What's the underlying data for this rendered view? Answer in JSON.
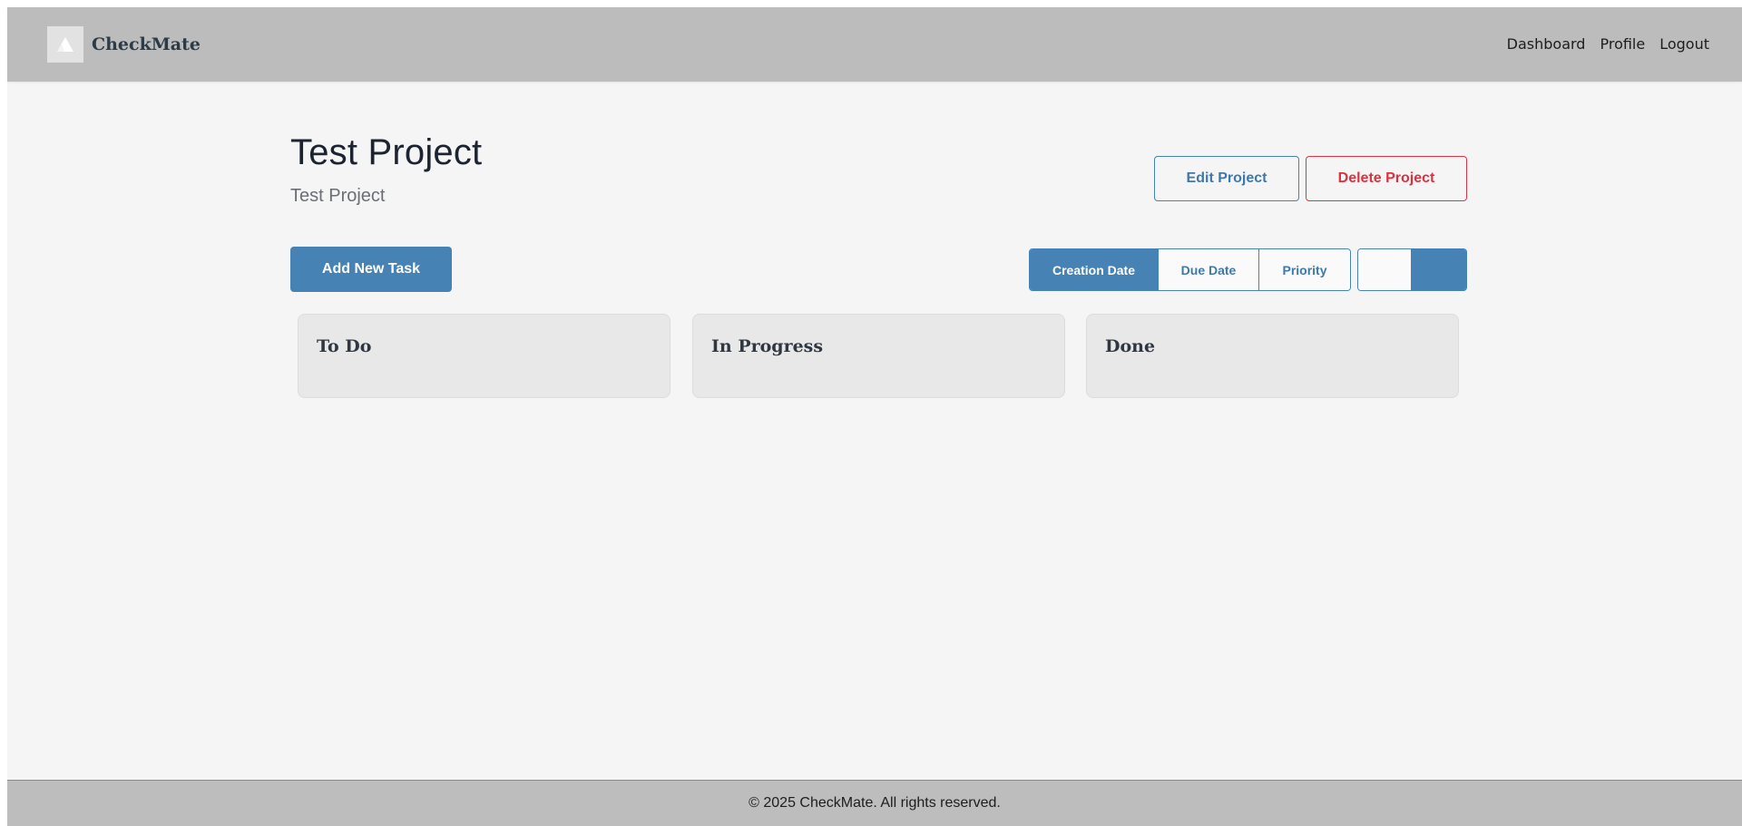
{
  "app": {
    "brand": "CheckMate"
  },
  "nav": {
    "items": [
      {
        "label": "Dashboard"
      },
      {
        "label": "Profile"
      },
      {
        "label": "Logout"
      }
    ]
  },
  "project": {
    "title": "Test Project",
    "description": "Test Project",
    "edit_label": "Edit Project",
    "delete_label": "Delete Project"
  },
  "toolbar": {
    "add_task_label": "Add New Task",
    "sort_options": [
      {
        "label": "Creation Date",
        "active": true
      },
      {
        "label": "Due Date",
        "active": false
      },
      {
        "label": "Priority",
        "active": false
      }
    ],
    "order_options": [
      {
        "name": "ascending",
        "active": false
      },
      {
        "name": "descending",
        "active": true
      }
    ]
  },
  "board": {
    "columns": [
      {
        "title": "To Do"
      },
      {
        "title": "In Progress"
      },
      {
        "title": "Done"
      }
    ]
  },
  "footer": {
    "text": "© 2025 CheckMate. All rights reserved."
  },
  "colors": {
    "accent": "#4682b4",
    "danger": "#dc3545",
    "navbar": "#bcbcbc",
    "background": "#f5f5f5",
    "column": "#e8e8e8"
  }
}
